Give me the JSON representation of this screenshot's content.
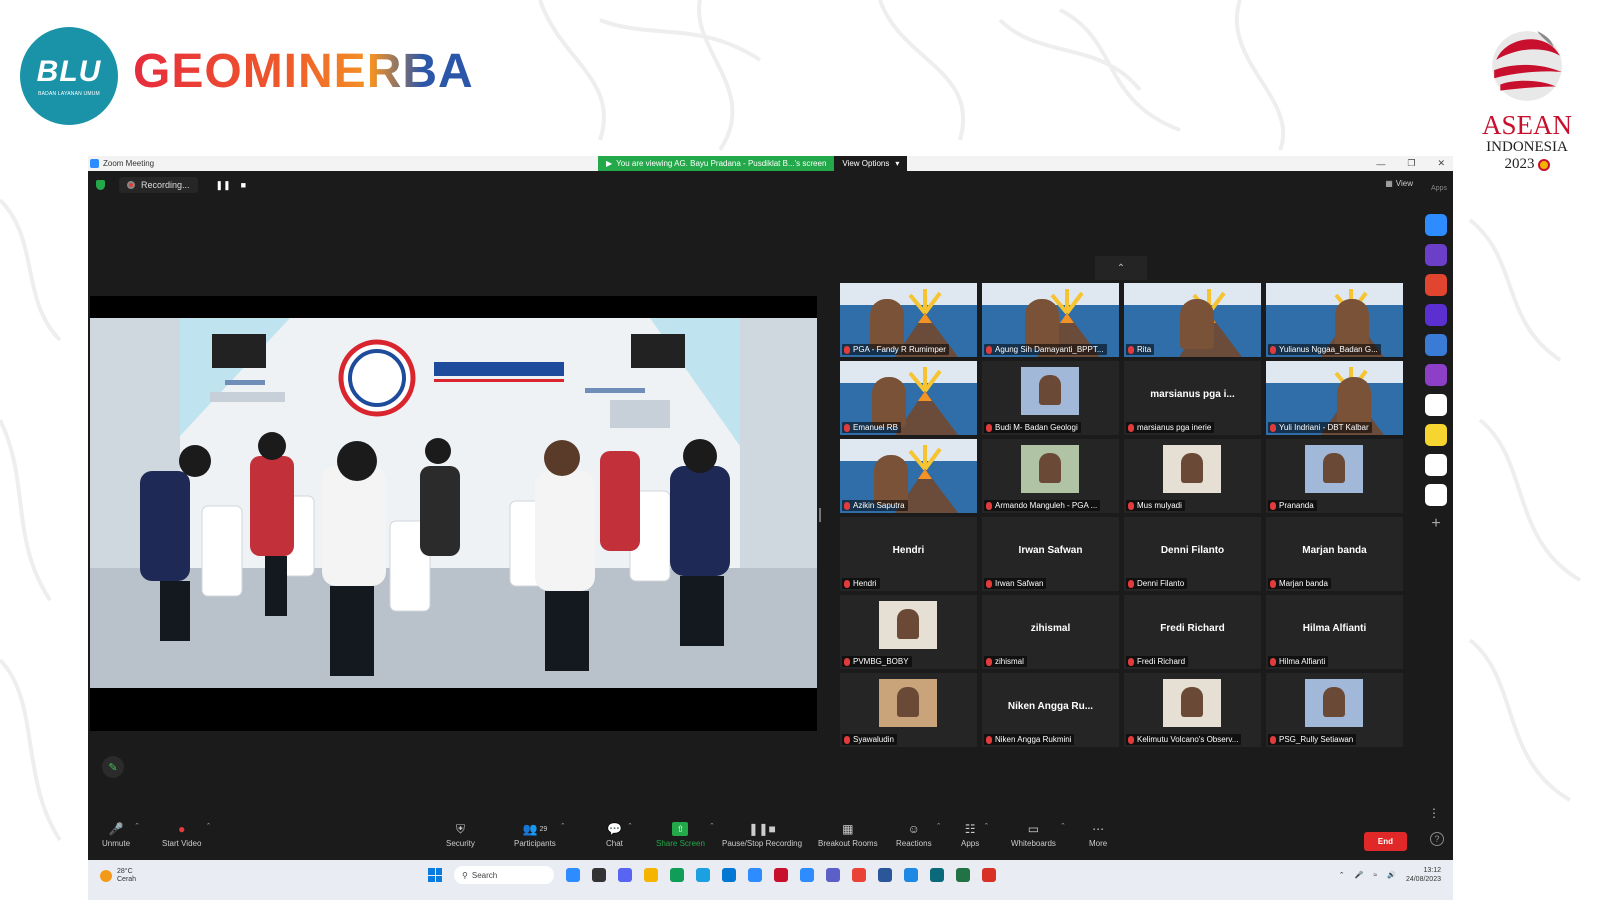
{
  "branding": {
    "blu_text": "BLU",
    "blu_sub": "BADAN LAYANAN UMUM",
    "brand_name": "GEOMINERBA",
    "asean_word": "ASEAN",
    "asean_country": "INDONESIA",
    "asean_year": "2023"
  },
  "window": {
    "title": "Zoom Meeting",
    "share_banner": "You are viewing AG. Bayu Pradana - Pusdiklat B...'s screen",
    "view_options": "View Options",
    "recording_label": "Recording...",
    "view_label": "View",
    "apps_label": "Apps"
  },
  "colors": {
    "zoom_bg": "#1b1b1b",
    "share_green": "#23a94a",
    "end_red": "#e02828",
    "brand_teal": "#1a93a8"
  },
  "sidebar_apps": [
    "#2d8cff",
    "#6b3fc7",
    "#e2452f",
    "#5b2fd0",
    "#3a7bd5",
    "#8e3fc7",
    "#ffffff",
    "#f6d531",
    "#ffffff",
    "#ffffff"
  ],
  "participants": [
    {
      "label": "PGA - Fandy R Rumimper",
      "type": "video"
    },
    {
      "label": "Agung Sih Damayanti_BPPT...",
      "type": "video"
    },
    {
      "label": "Rita",
      "type": "video"
    },
    {
      "label": "Yulianus Nggaa_Badan G...",
      "type": "video"
    },
    {
      "label": "Emanuel RB",
      "type": "video"
    },
    {
      "label": "Budi M- Badan Geologi",
      "type": "photo"
    },
    {
      "label": "marsianus pga inerie",
      "name": "marsianus pga i...",
      "type": "name"
    },
    {
      "label": "Yuli Indriani - DBT Kalbar",
      "type": "video"
    },
    {
      "label": "Azikin Saputra",
      "type": "video"
    },
    {
      "label": "Armando Manguleh - PGA ...",
      "type": "photo"
    },
    {
      "label": "Mus mulyadi",
      "type": "photo"
    },
    {
      "label": "Prananda",
      "type": "photo"
    },
    {
      "label": "Hendri",
      "name": "Hendri",
      "type": "name"
    },
    {
      "label": "Irwan Safwan",
      "name": "Irwan Safwan",
      "type": "name"
    },
    {
      "label": "Denni Filanto",
      "name": "Denni Filanto",
      "type": "name"
    },
    {
      "label": "Marjan banda",
      "name": "Marjan banda",
      "type": "name"
    },
    {
      "label": "PVMBG_BOBY",
      "type": "photo"
    },
    {
      "label": "zihismal",
      "name": "zihismal",
      "type": "name"
    },
    {
      "label": "Fredi Richard",
      "name": "Fredi Richard",
      "type": "name"
    },
    {
      "label": "Hilma Alfianti",
      "name": "Hilma Alfianti",
      "type": "name"
    },
    {
      "label": "Syawaludin",
      "type": "photo"
    },
    {
      "label": "Niken Angga Rukmini",
      "name": "Niken Angga Ru...",
      "type": "name"
    },
    {
      "label": "Kelimutu Volcano's Observ...",
      "type": "photo"
    },
    {
      "label": "PSG_Rully Setiawan",
      "type": "photo"
    }
  ],
  "toolbar": {
    "unmute": "Unmute",
    "start_video": "Start Video",
    "security": "Security",
    "participants": "Participants",
    "participants_count": "29",
    "chat": "Chat",
    "share_screen": "Share Screen",
    "pause_stop": "Pause/Stop Recording",
    "breakout": "Breakout Rooms",
    "reactions": "Reactions",
    "apps": "Apps",
    "whiteboards": "Whiteboards",
    "more": "More",
    "end": "End"
  },
  "taskbar": {
    "temperature": "28°C",
    "weather": "Cerah",
    "search_placeholder": "Search",
    "time": "13:12",
    "date": "24/08/2023"
  }
}
